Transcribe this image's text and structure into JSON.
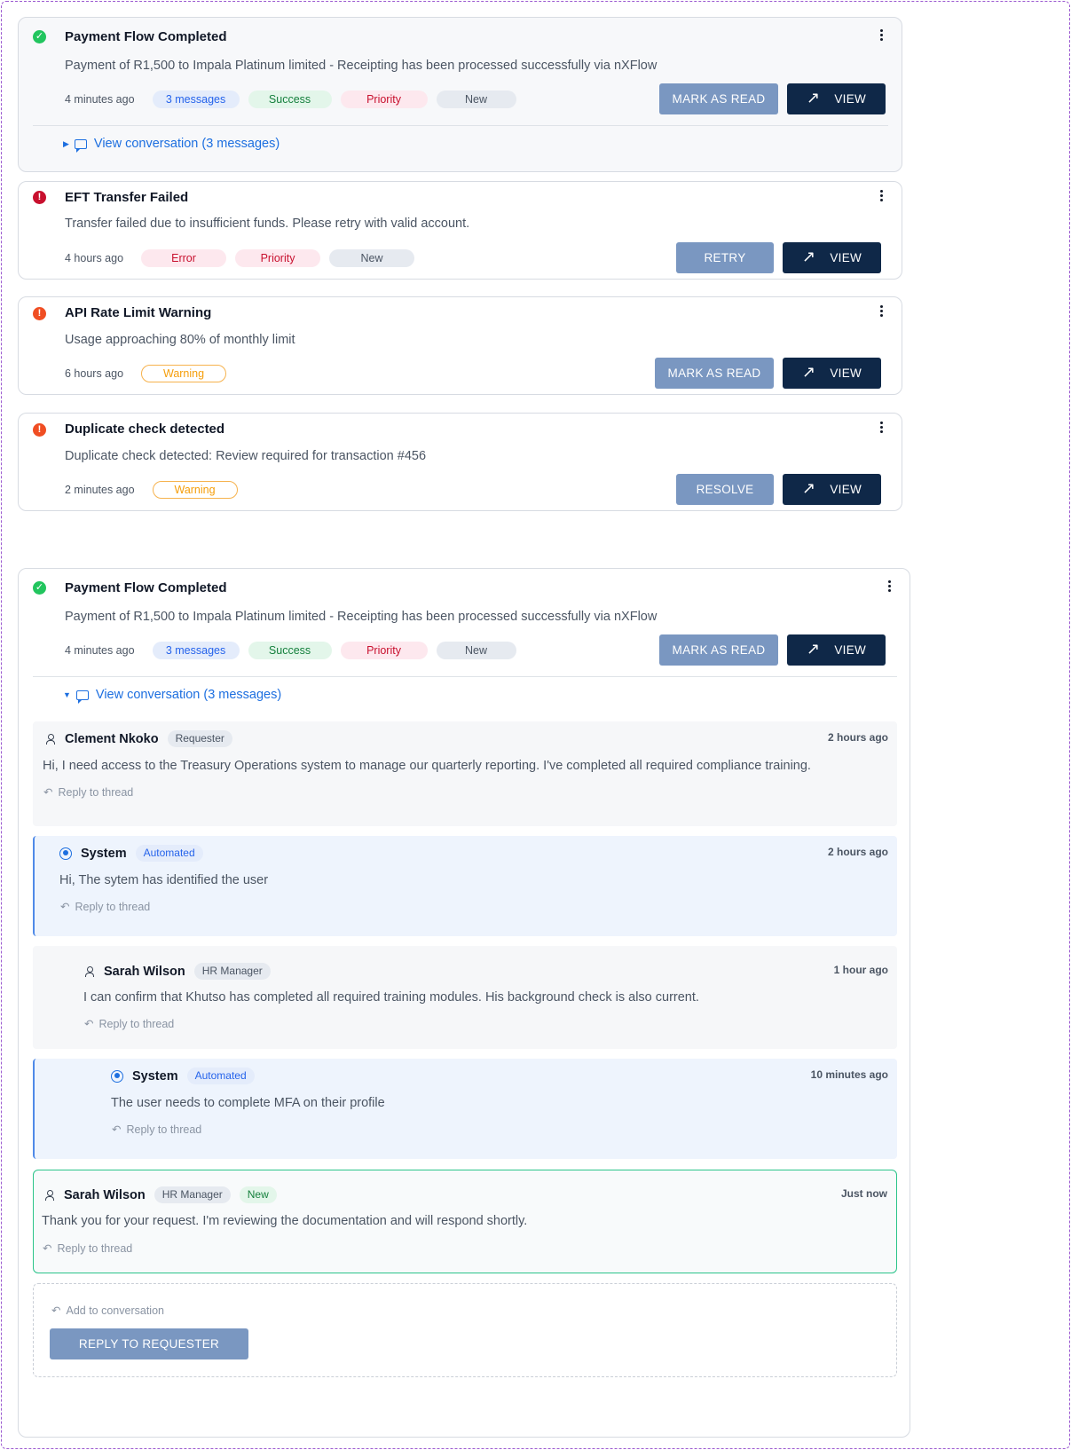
{
  "cards": [
    {
      "title": "Payment Flow Completed",
      "description": "Payment of R1,500 to Impala Platinum limited - Receipting has been processed successfully via nXFlow",
      "time": "4 minutes ago",
      "tags": [
        "3 messages",
        "Success",
        "Priority",
        "New"
      ],
      "secondary_action": "MARK AS READ",
      "view_label": "VIEW",
      "conversation_link": "View conversation (3 messages)"
    },
    {
      "title": "EFT Transfer Failed",
      "description": "Transfer failed due to insufficient funds. Please retry with valid account.",
      "time": "4 hours ago",
      "tags": [
        "Error",
        "Priority",
        "New"
      ],
      "secondary_action": "RETRY",
      "view_label": "VIEW"
    },
    {
      "title": "API Rate Limit Warning",
      "description": "Usage approaching 80% of monthly limit",
      "time": "6 hours ago",
      "tags": [
        "Warning"
      ],
      "secondary_action": "MARK AS READ",
      "view_label": "VIEW"
    },
    {
      "title": "Duplicate check detected",
      "description": "Duplicate check detected: Review required for transaction #456",
      "time": "2 minutes ago",
      "tags": [
        "Warning"
      ],
      "secondary_action": "RESOLVE",
      "view_label": "VIEW"
    }
  ],
  "expanded": {
    "title": "Payment Flow Completed",
    "description": "Payment of R1,500 to Impala Platinum limited - Receipting has been processed successfully via nXFlow",
    "time": "4 minutes ago",
    "tags": [
      "3 messages",
      "Success",
      "Priority",
      "New"
    ],
    "secondary_action": "MARK AS READ",
    "view_label": "VIEW",
    "conversation_link": "View conversation (3 messages)",
    "messages": [
      {
        "author": "Clement Nkoko",
        "role": "Requester",
        "time": "2 hours ago",
        "text": "Hi, I need access to the Treasury Operations system to manage our quarterly reporting. I've completed all required compliance training.",
        "reply": "Reply to thread"
      },
      {
        "author": "System",
        "role": "Automated",
        "time": "2 hours ago",
        "text": "Hi, The sytem has identified the user",
        "reply": "Reply to thread"
      },
      {
        "author": "Sarah Wilson",
        "role": "HR Manager",
        "time": "1 hour ago",
        "text": "I can confirm that Khutso has completed all required training modules. His background check is also current.",
        "reply": "Reply to thread"
      },
      {
        "author": "System",
        "role": "Automated",
        "time": "10 minutes ago",
        "text": "The user needs to complete MFA on their profile",
        "reply": "Reply to thread"
      },
      {
        "author": "Sarah Wilson",
        "role": "HR Manager",
        "badge": "New",
        "time": "Just now",
        "text": "Thank you for your request. I'm reviewing the documentation and will respond shortly.",
        "reply": "Reply to thread"
      }
    ],
    "add_conversation": "Add to conversation",
    "reply_button": "REPLY TO REQUESTER"
  },
  "icons": {
    "success": "check-circle-icon",
    "error": "alert-circle-icon",
    "warning": "alert-circle-icon",
    "menu": "more-vertical-icon",
    "view": "arrow-up-right-icon",
    "conversation": "message-square-icon",
    "person": "user-icon",
    "system": "radio-icon",
    "reply": "reply-icon"
  },
  "colors": {
    "success": "#22c55e",
    "error": "#c8102e",
    "warning": "#f04e23",
    "primary_dark": "#0f2848",
    "secondary_button": "#7a97c1",
    "link": "#1d6fe0"
  }
}
